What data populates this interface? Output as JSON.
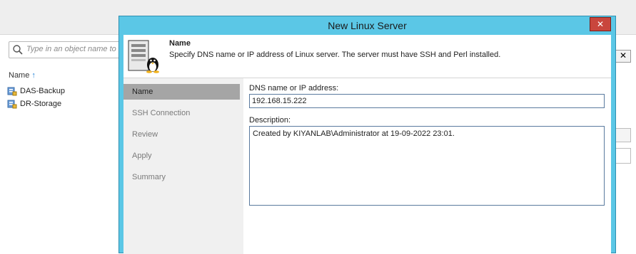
{
  "background": {
    "search": {
      "placeholder": "Type in an object name to s"
    },
    "column_header": {
      "label": "Name",
      "sort_arrow": "↑"
    },
    "tree_items": [
      {
        "label": "DAS-Backup",
        "icon": "storage-icon"
      },
      {
        "label": "DR-Storage",
        "icon": "storage-icon"
      }
    ],
    "close_glyph": "✕"
  },
  "dialog": {
    "title": "New Linux Server",
    "close_glyph": "✕",
    "header": {
      "title": "Name",
      "subtitle": "Specify DNS name or IP address of Linux server. The server must have SSH and Perl installed."
    },
    "steps": [
      {
        "label": "Name",
        "active": true
      },
      {
        "label": "SSH Connection",
        "active": false
      },
      {
        "label": "Review",
        "active": false
      },
      {
        "label": "Apply",
        "active": false
      },
      {
        "label": "Summary",
        "active": false
      }
    ],
    "form": {
      "dns_label": "DNS name or IP address:",
      "dns_value": "192.168.15.222",
      "description_label": "Description:",
      "description_value": "Created by KIYANLAB\\Administrator at 19-09-2022 23:01."
    }
  },
  "colors": {
    "dialog_frame": "#5bc7e6",
    "close_button": "#c9463d",
    "active_step": "#a5a5a5",
    "sort_arrow": "#1c7fd6"
  }
}
